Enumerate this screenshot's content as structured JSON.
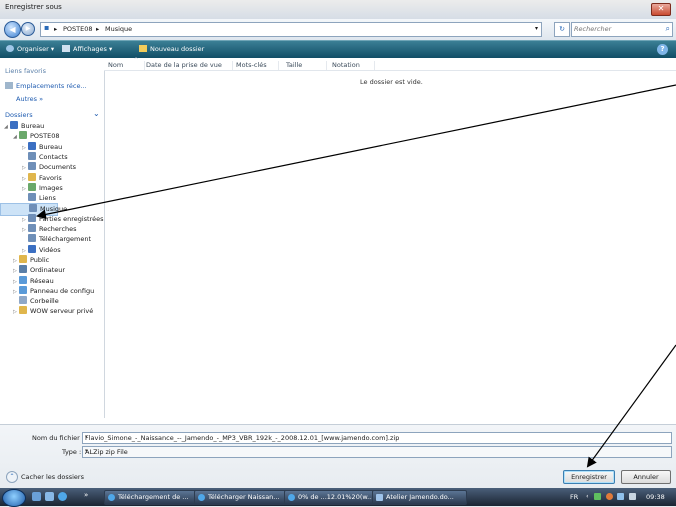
{
  "window": {
    "title": "Enregistrer sous",
    "close_glyph": "✕"
  },
  "address": {
    "back_glyph": "◀",
    "forward_glyph": "▶",
    "separator": "▸",
    "crumbs": [
      "POSTE08",
      "Musique"
    ],
    "dropdown_glyph": "▾",
    "refresh_glyph": "↻",
    "search_placeholder": "Rechercher"
  },
  "toolbar": {
    "organize": "Organiser",
    "views": "Affichages",
    "new_folder": "Nouveau dossier",
    "caret": "▾",
    "help_glyph": "?"
  },
  "sidebar": {
    "favorites_header": "Liens favoris",
    "recent_places": "Emplacements réce...",
    "more": "Autres  »",
    "folders_header": "Dossiers",
    "folders_toggle": "⌄",
    "tree": [
      {
        "label": "Bureau",
        "indent": 0,
        "expander": "◢",
        "icon_color": "#3b6fc2"
      },
      {
        "label": "POSTE08",
        "indent": 1,
        "expander": "◢",
        "icon_color": "#6aa86a"
      },
      {
        "label": "Bureau",
        "indent": 2,
        "expander": "▷",
        "icon_color": "#3b6fc2"
      },
      {
        "label": "Contacts",
        "indent": 2,
        "expander": "",
        "icon_color": "#6f8fb8"
      },
      {
        "label": "Documents",
        "indent": 2,
        "expander": "▷",
        "icon_color": "#6f8fb8"
      },
      {
        "label": "Favoris",
        "indent": 2,
        "expander": "▷",
        "icon_color": "#e0b64c"
      },
      {
        "label": "Images",
        "indent": 2,
        "expander": "▷",
        "icon_color": "#6aa86a"
      },
      {
        "label": "Liens",
        "indent": 2,
        "expander": "",
        "icon_color": "#6f8fb8"
      },
      {
        "label": "Musique",
        "indent": 2,
        "expander": "",
        "icon_color": "#6f8fb8",
        "selected": true
      },
      {
        "label": "Parties enregistrées",
        "indent": 2,
        "expander": "▷",
        "icon_color": "#6f8fb8"
      },
      {
        "label": "Recherches",
        "indent": 2,
        "expander": "▷",
        "icon_color": "#6f8fb8"
      },
      {
        "label": "Téléchargement",
        "indent": 2,
        "expander": "",
        "icon_color": "#6f8fb8"
      },
      {
        "label": "Vidéos",
        "indent": 2,
        "expander": "▷",
        "icon_color": "#3b6fc2"
      },
      {
        "label": "Public",
        "indent": 1,
        "expander": "▷",
        "icon_color": "#e0b64c"
      },
      {
        "label": "Ordinateur",
        "indent": 1,
        "expander": "▷",
        "icon_color": "#5a7fa8"
      },
      {
        "label": "Réseau",
        "indent": 1,
        "expander": "▷",
        "icon_color": "#5a9ad8"
      },
      {
        "label": "Panneau de configu",
        "indent": 1,
        "expander": "▷",
        "icon_color": "#5a9ad8"
      },
      {
        "label": "Corbeille",
        "indent": 1,
        "expander": "",
        "icon_color": "#8fa8c8"
      },
      {
        "label": "WOW serveur privé",
        "indent": 1,
        "expander": "▷",
        "icon_color": "#e0b64c"
      }
    ]
  },
  "filelist": {
    "columns": [
      "Nom",
      "Date de la prise de vue",
      "Mots-clés",
      "Taille",
      "Notation"
    ],
    "sort_glyph": "^",
    "empty_message": "Le dossier est vide."
  },
  "form": {
    "filename_label": "Nom du fichier :",
    "filename_value": "Flavio_Simone_-_Naissance_--_Jamendo_-_MP3_VBR_192k_-_2008.12.01_[www.jamendo.com].zip",
    "type_label": "Type :",
    "type_value": "ALZip zip File",
    "dd_glyph": "▾",
    "hide_folders": "Cacher les dossiers",
    "hide_glyph": "⌃",
    "save_button": "Enregistrer",
    "cancel_button": "Annuler"
  },
  "taskbar": {
    "quicklaunch_more": "»",
    "buttons": [
      "Téléchargement de ...",
      "Télécharger Naissan...",
      "0% de ...12.01%20(w...",
      "Atelier Jamendo.do..."
    ],
    "lang": "FR",
    "tray_glyph": "‹",
    "time": "09:38"
  },
  "colors": {
    "toolbar": "#1f5f77",
    "selection": "#cde3f7",
    "arrow": "#000000"
  }
}
